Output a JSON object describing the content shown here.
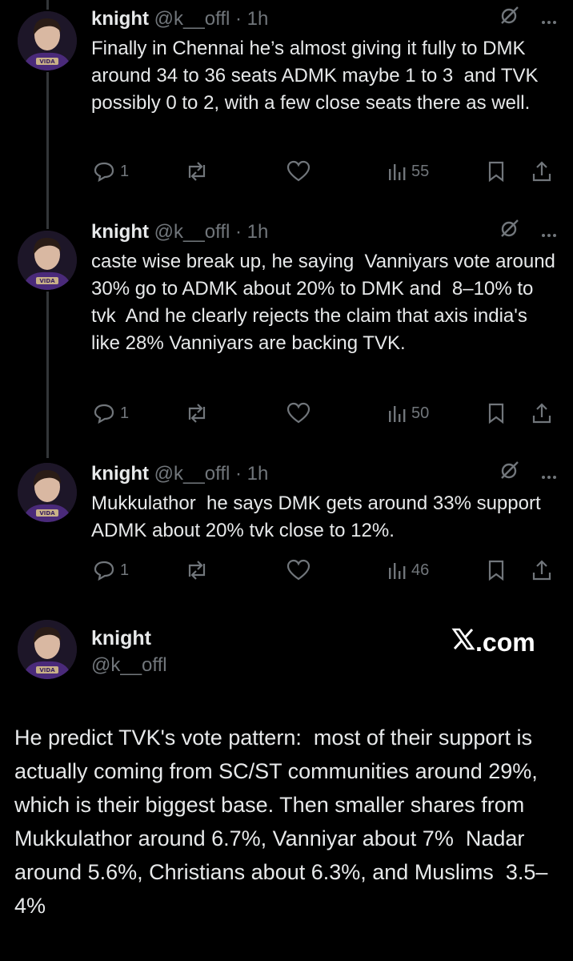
{
  "colors": {
    "background": "#000000",
    "text": "#e7e9ea",
    "muted": "#71767b",
    "thread_line": "#333639"
  },
  "avatar": {
    "jersey_text": "VIDA"
  },
  "tweets": [
    {
      "name": "knight",
      "handle": "@k__offl",
      "sep": "·",
      "time": "1h",
      "text": "Finally in Chennai he’s almost giving it fully to DMK  around 34 to 36 seats ADMK maybe 1 to 3  and TVK possibly 0 to 2, with a few close seats there as well.",
      "replies": "1",
      "views": "55"
    },
    {
      "name": "knight",
      "handle": "@k__offl",
      "sep": "·",
      "time": "1h",
      "text": "caste wise break up, he saying  Vanniyars vote around 30% go to ADMK about 20% to DMK and  8–10% to tvk  And he clearly rejects the claim that axis india's like 28% Vanniyars are backing TVK.",
      "replies": "1",
      "views": "50"
    },
    {
      "name": "knight",
      "handle": "@k__offl",
      "sep": "·",
      "time": "1h",
      "text": "Mukkulathor  he says DMK gets around 33% support  ADMK about 20% tvk close to 12%.",
      "replies": "1",
      "views": "46"
    }
  ],
  "main_post": {
    "name": "knight",
    "handle": "@k__offl",
    "brand": ".com",
    "text": "He predict TVK's vote pattern:  most of their support is actually coming from SC/ST communities around 29%, which is their biggest base. Then smaller shares from Mukkulathor around 6.7%, Vanniyar about 7%  Nadar around 5.6%, Christians about 6.3%, and Muslims  3.5–4%"
  },
  "icons": {
    "reply": "reply-icon",
    "repost": "repost-icon",
    "like": "heart-icon",
    "views": "views-icon",
    "bookmark": "bookmark-icon",
    "share": "share-icon",
    "grok": "grok-icon",
    "more": "more-icon",
    "brand_logo": "x-logo-icon"
  }
}
